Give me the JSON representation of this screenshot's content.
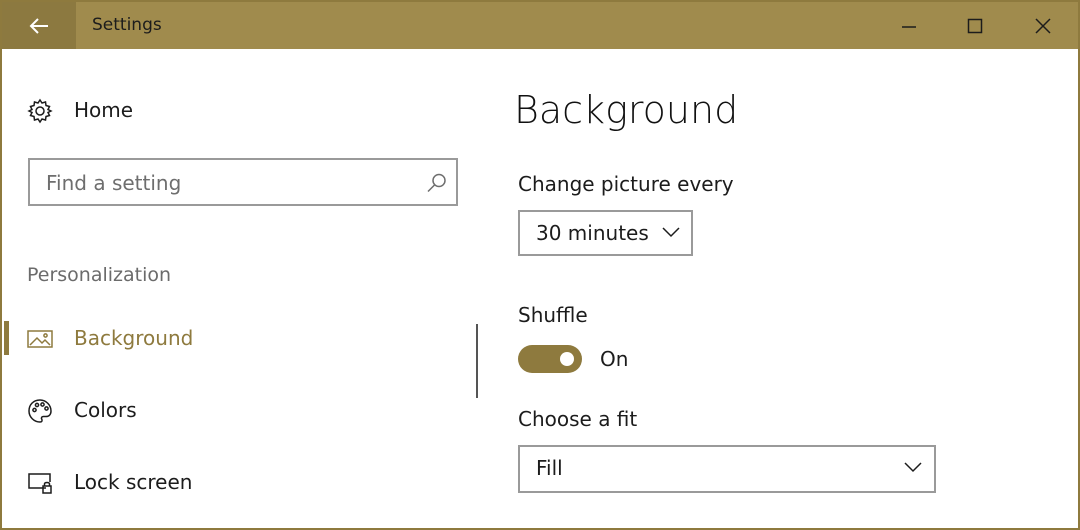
{
  "window": {
    "title": "Settings",
    "accent_color": "#8e7a3e",
    "titlebar_color": "#a08b4d"
  },
  "sidebar": {
    "home_label": "Home",
    "search_placeholder": "Find a setting",
    "section_title": "Personalization",
    "items": [
      {
        "label": "Background",
        "icon": "picture-icon",
        "active": true
      },
      {
        "label": "Colors",
        "icon": "palette-icon",
        "active": false
      },
      {
        "label": "Lock screen",
        "icon": "lock-screen-icon",
        "active": false
      }
    ]
  },
  "main": {
    "title": "Background",
    "change_picture_label": "Change picture every",
    "change_picture_value": "30 minutes",
    "shuffle_label": "Shuffle",
    "shuffle_state": "On",
    "fit_label": "Choose a fit",
    "fit_value": "Fill"
  }
}
